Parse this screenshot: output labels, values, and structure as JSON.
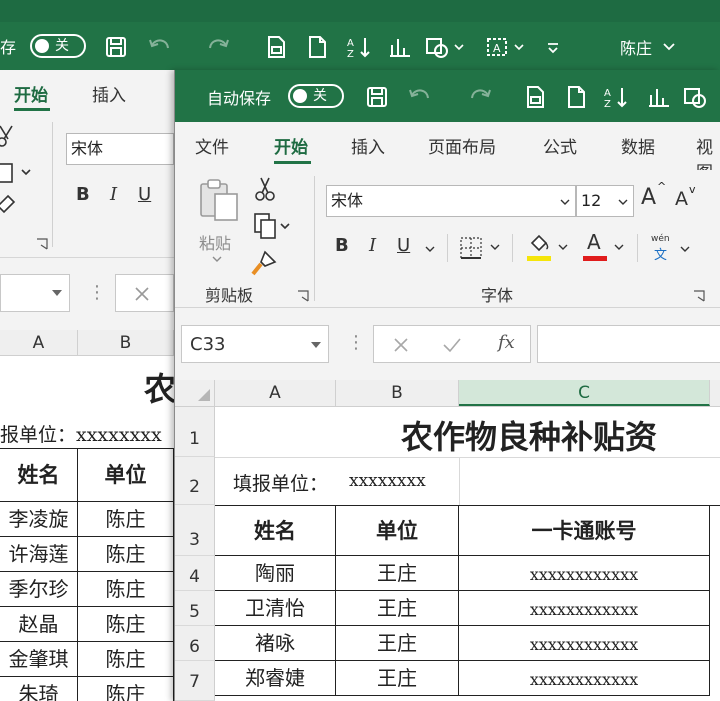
{
  "back_window": {
    "autosave_label": "存",
    "autosave_toggle": "关",
    "user_name": "陈庄",
    "tabs": [
      {
        "label": "开始",
        "active": true
      },
      {
        "label": "插入",
        "active": false
      }
    ],
    "font_name": "宋体",
    "col_headers": [
      "A",
      "B"
    ],
    "title_fragment": "农",
    "fill_unit": "报单位：xxxxxxxx",
    "headers": [
      "姓名",
      "单位"
    ],
    "rows": [
      {
        "name": "李凌旋",
        "unit": "陈庄"
      },
      {
        "name": "许海莲",
        "unit": "陈庄"
      },
      {
        "name": "季尔珍",
        "unit": "陈庄"
      },
      {
        "name": "赵晶",
        "unit": "陈庄"
      },
      {
        "name": "金肇琪",
        "unit": "陈庄"
      },
      {
        "name": "朱琦",
        "unit": "陈庄"
      }
    ]
  },
  "front_window": {
    "autosave_label": "自动保存",
    "autosave_toggle": "关",
    "tabs": [
      {
        "label": "文件",
        "active": false
      },
      {
        "label": "开始",
        "active": true
      },
      {
        "label": "插入",
        "active": false
      },
      {
        "label": "页面布局",
        "active": false
      },
      {
        "label": "公式",
        "active": false
      },
      {
        "label": "数据",
        "active": false
      },
      {
        "label": "视图",
        "active": false
      }
    ],
    "clipboard": {
      "paste_label": "粘贴",
      "group_label": "剪贴板"
    },
    "font": {
      "group_label": "字体",
      "font_name": "宋体",
      "font_size": "12",
      "bold": "B",
      "italic": "I",
      "underline": "U",
      "grow": "A",
      "shrink": "A",
      "font_color_letter": "A",
      "phonetic_top": "wén",
      "phonetic_bottom": "文",
      "highlight_color": "#f5e50a",
      "font_color": "#e01c1c"
    },
    "name_box": "C33",
    "fx_label": "fx",
    "col_headers": [
      "A",
      "B",
      "C"
    ],
    "row_numbers": [
      "1",
      "2",
      "3",
      "4",
      "5",
      "6",
      "7"
    ],
    "sheet": {
      "title": "农作物良种补贴资",
      "fill_unit_label": "填报单位：",
      "fill_unit_value": "xxxxxxxx",
      "headers": [
        "姓名",
        "单位",
        "一卡通账号"
      ],
      "rows": [
        {
          "name": "陶丽",
          "unit": "王庄",
          "account": "xxxxxxxxxxxx"
        },
        {
          "name": "卫清怡",
          "unit": "王庄",
          "account": "xxxxxxxxxxxx"
        },
        {
          "name": "褚咏",
          "unit": "王庄",
          "account": "xxxxxxxxxxxx"
        },
        {
          "name": "郑睿婕",
          "unit": "王庄",
          "account": "xxxxxxxxxxxx"
        }
      ]
    }
  },
  "colors": {
    "excel_green": "#217346",
    "ribbon_bg": "#f3f3f3",
    "header_bg": "#efefef",
    "selected_col": "#d3e7d9"
  }
}
